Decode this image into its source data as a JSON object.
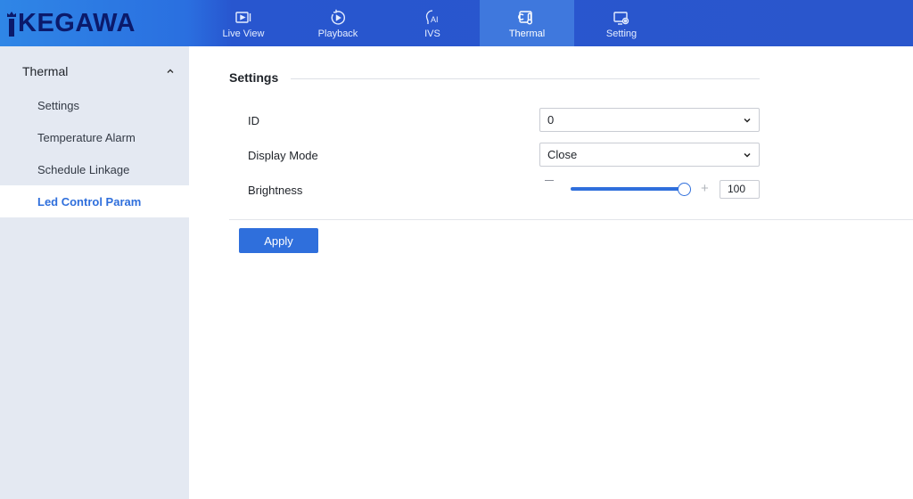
{
  "brand": {
    "name": "KEGAWA"
  },
  "nav": {
    "items": [
      {
        "label": "Live View",
        "icon": "live-view-icon"
      },
      {
        "label": "Playback",
        "icon": "playback-icon"
      },
      {
        "label": "IVS",
        "icon": "ivs-ai-icon"
      },
      {
        "label": "Thermal",
        "icon": "thermal-icon",
        "active": true
      },
      {
        "label": "Setting",
        "icon": "setting-icon"
      }
    ]
  },
  "sidebar": {
    "group_label": "Thermal",
    "items": [
      {
        "label": "Settings"
      },
      {
        "label": "Temperature Alarm"
      },
      {
        "label": "Schedule Linkage"
      },
      {
        "label": "Led Control Param",
        "active": true
      }
    ]
  },
  "main": {
    "section_title": "Settings",
    "id_label": "ID",
    "id_value": "0",
    "display_mode_label": "Display Mode",
    "display_mode_value": "Close",
    "brightness_label": "Brightness",
    "brightness_value": "100",
    "brightness_level": 1.0,
    "apply_label": "Apply"
  },
  "colors": {
    "accent": "#2f6fdc",
    "topbar": "#2a56cc",
    "sidebar_bg": "#e4e9f2",
    "logo": "#0b1a6b"
  }
}
